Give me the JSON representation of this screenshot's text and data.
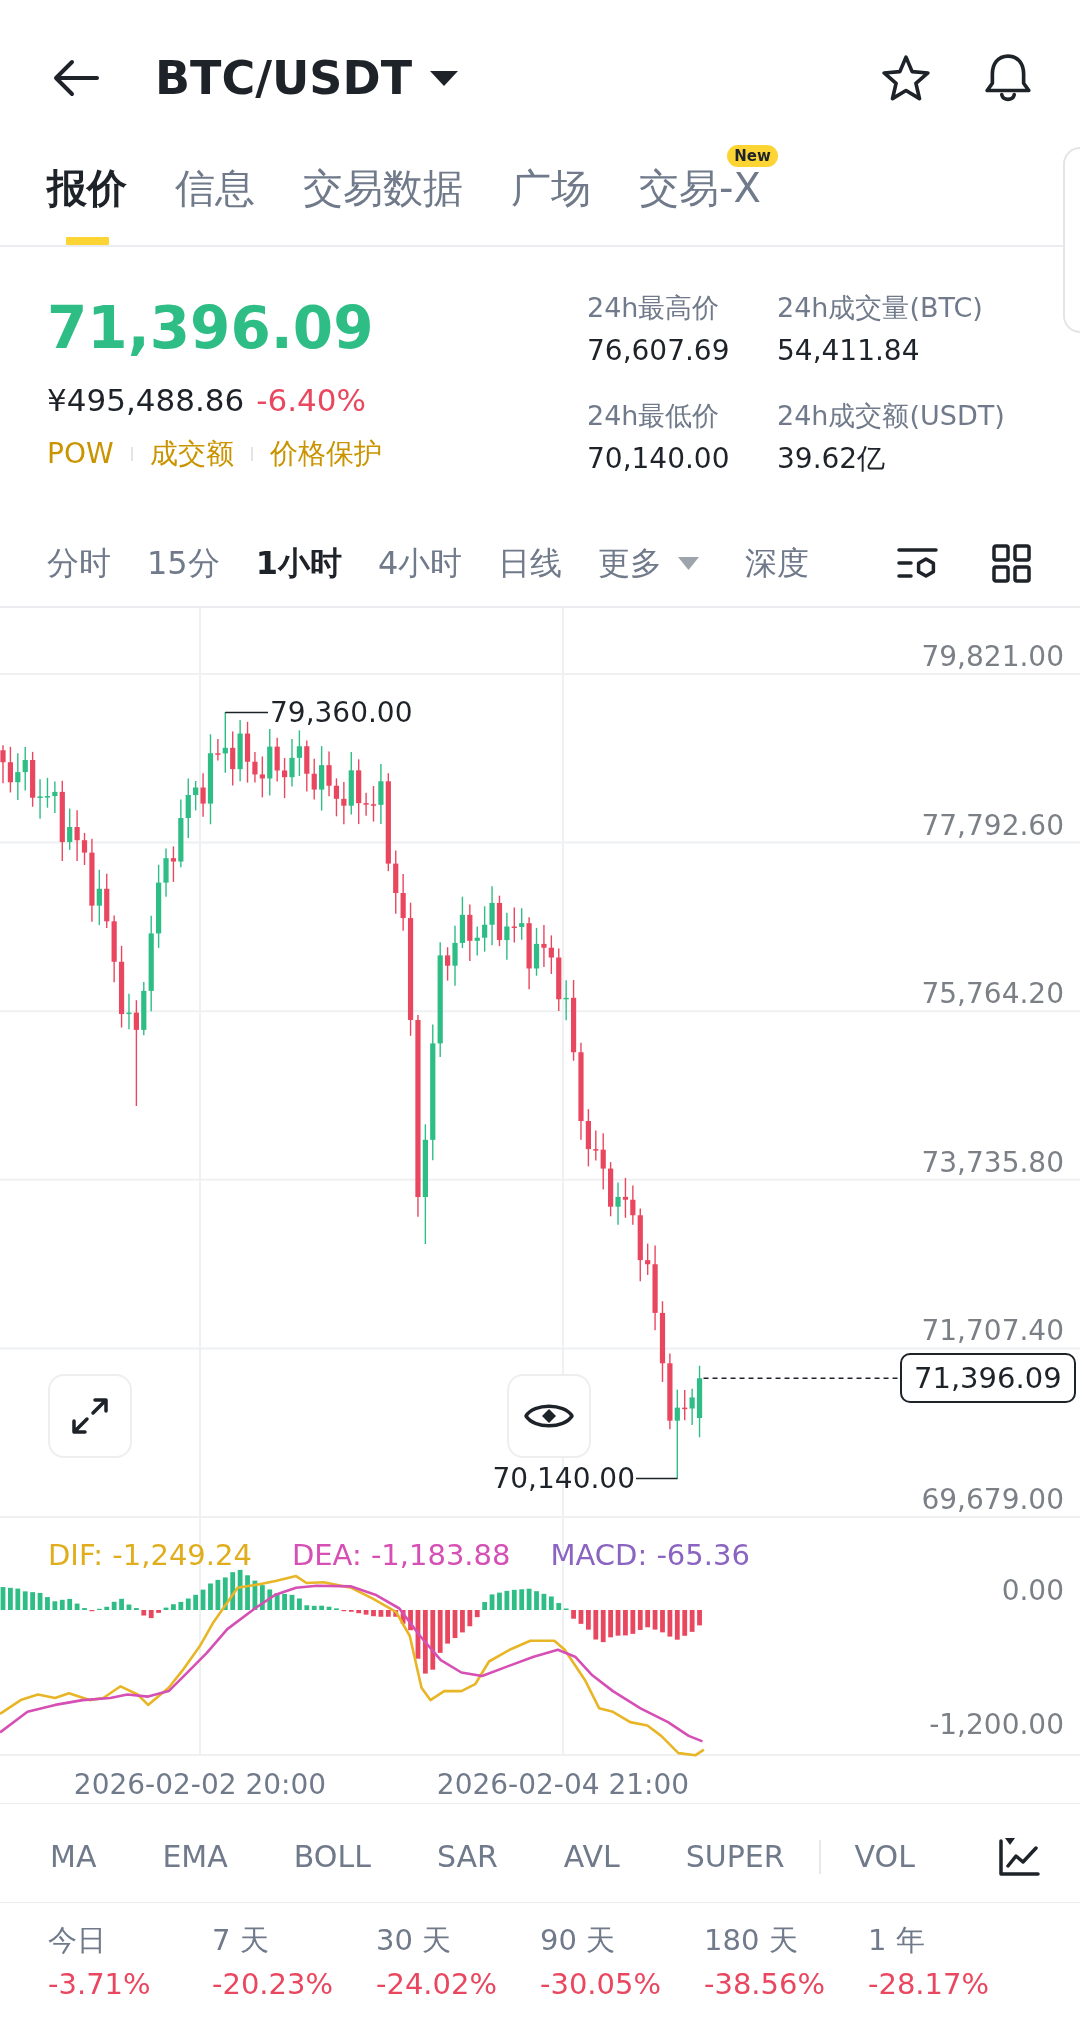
{
  "header": {
    "title": "BTC/USDT"
  },
  "tabs": [
    {
      "label": "报价",
      "selected": true
    },
    {
      "label": "信息",
      "selected": false
    },
    {
      "label": "交易数据",
      "selected": false
    },
    {
      "label": "广场",
      "selected": false
    },
    {
      "label": "交易-X",
      "selected": false,
      "badge": "New"
    }
  ],
  "price": {
    "last": {
      "text": "71,396.09",
      "falling": false
    },
    "fiat": "¥495,488.86",
    "change": {
      "text": "-6.40%",
      "falling": true
    },
    "tags": [
      "POW",
      "成交额",
      "价格保护"
    ]
  },
  "stats": [
    {
      "label": "24h最高价",
      "value": "76,607.69"
    },
    {
      "label": "24h成交量(BTC)",
      "value": "54,411.84"
    },
    {
      "label": "24h最低价",
      "value": "70,140.00"
    },
    {
      "label": "24h成交额(USDT)",
      "value": "39.62亿"
    }
  ],
  "intervals": [
    {
      "label": "分时",
      "kind": "option",
      "selected": false
    },
    {
      "label": "15分",
      "kind": "option",
      "selected": false
    },
    {
      "label": "1小时",
      "kind": "option",
      "selected": true
    },
    {
      "label": "4小时",
      "kind": "option",
      "selected": false
    },
    {
      "label": "日线",
      "kind": "option",
      "selected": false
    },
    {
      "label": "更多",
      "kind": "dropdown",
      "selected": false
    },
    {
      "label": "深度",
      "kind": "option",
      "selected": false
    }
  ],
  "chart": {
    "price_axis": [
      "79,821.00",
      "77,792.60",
      "75,764.20",
      "73,735.80",
      "71,707.40",
      "69,679.00"
    ],
    "high_marker": "79,360.00",
    "low_marker": "70,140.00",
    "last_price": "71,396.09",
    "macd_legend": {
      "dif": "DIF: -1,249.24",
      "dea": "DEA: -1,183.88",
      "macd": "MACD: -65.36"
    },
    "macd_axis": [
      "0.00",
      "-1,200.00"
    ],
    "time_axis": [
      "2026-02-02 20:00",
      "2026-02-04 21:00"
    ]
  },
  "indicators": {
    "main": [
      "MA",
      "EMA",
      "BOLL",
      "SAR",
      "AVL",
      "SUPER"
    ],
    "sub": [
      "VOL"
    ]
  },
  "performance": [
    {
      "period": "今日",
      "change": "-3.71%",
      "falling": true
    },
    {
      "period": "7 天",
      "change": "-20.23%",
      "falling": true
    },
    {
      "period": "30 天",
      "change": "-24.02%",
      "falling": true
    },
    {
      "period": "90 天",
      "change": "-30.05%",
      "falling": true
    },
    {
      "period": "180 天",
      "change": "-38.56%",
      "falling": true
    },
    {
      "period": "1 年",
      "change": "-28.17%",
      "falling": true
    }
  ]
}
